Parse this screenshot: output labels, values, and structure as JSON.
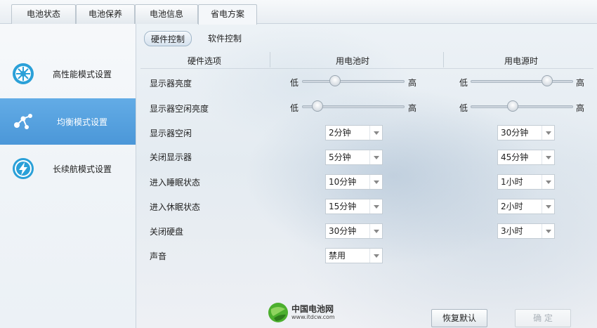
{
  "tabs": [
    {
      "label": "电池状态"
    },
    {
      "label": "电池保养"
    },
    {
      "label": "电池信息"
    },
    {
      "label": "省电方案",
      "active": true
    }
  ],
  "sidebar": {
    "items": [
      {
        "label": "高性能模式设置",
        "icon": "fan-icon",
        "active": false
      },
      {
        "label": "均衡模式设置",
        "icon": "nodes-icon",
        "active": true
      },
      {
        "label": "长续航模式设置",
        "icon": "lightning-icon",
        "active": false
      }
    ]
  },
  "subtabs": {
    "hardware": "硬件控制",
    "software": "软件控制"
  },
  "table_header": {
    "option": "硬件选项",
    "battery": "用电池时",
    "power": "用电源时"
  },
  "slider_labels": {
    "low": "低",
    "high": "高"
  },
  "rows": [
    {
      "label": "显示器亮度",
      "battery_level": 0.28,
      "power_level": 0.87
    },
    {
      "label": "显示器空闲亮度",
      "battery_level": 0.08,
      "power_level": 0.37
    },
    {
      "label": "显示器空闲",
      "battery": "2分钟",
      "power": "30分钟"
    },
    {
      "label": "关闭显示器",
      "battery": "5分钟",
      "power": "45分钟"
    },
    {
      "label": "进入睡眠状态",
      "battery": "10分钟",
      "power": "1小时"
    },
    {
      "label": "进入休眠状态",
      "battery": "15分钟",
      "power": "2小时"
    },
    {
      "label": "关闭硬盘",
      "battery": "30分钟",
      "power": "3小时"
    },
    {
      "label": "声音",
      "battery": "禁用"
    }
  ],
  "footer": {
    "logo_name": "中国电池网",
    "logo_url": "www.itdcw.com",
    "restore_label": "恢复默认",
    "ok_label": "确 定"
  },
  "colors": {
    "accent": "#4f9bdb",
    "icon_blue": "#2aa0d8"
  }
}
